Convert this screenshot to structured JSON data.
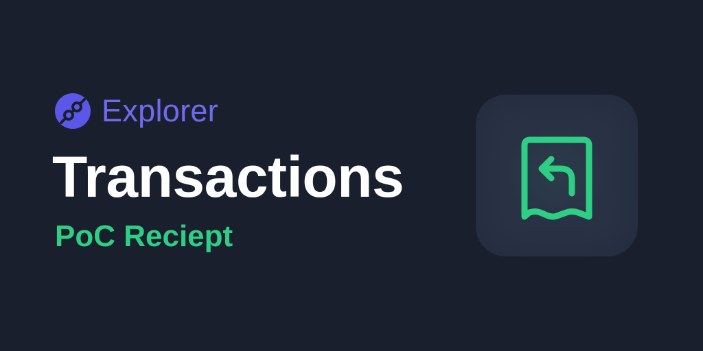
{
  "brand": {
    "name": "Explorer",
    "logo_icon": "helium-logo-icon",
    "logo_color": "#5c57e8",
    "name_color": "#6f6af0"
  },
  "page": {
    "title": "Transactions",
    "subtitle": "PoC Reciept",
    "title_color": "#ffffff",
    "subtitle_color": "#2ecf84",
    "background_color": "#1a1f2d"
  },
  "feature_icon": {
    "icon": "receipt-return-icon",
    "color": "#2ecf84",
    "tile_color": "#2a3346"
  }
}
